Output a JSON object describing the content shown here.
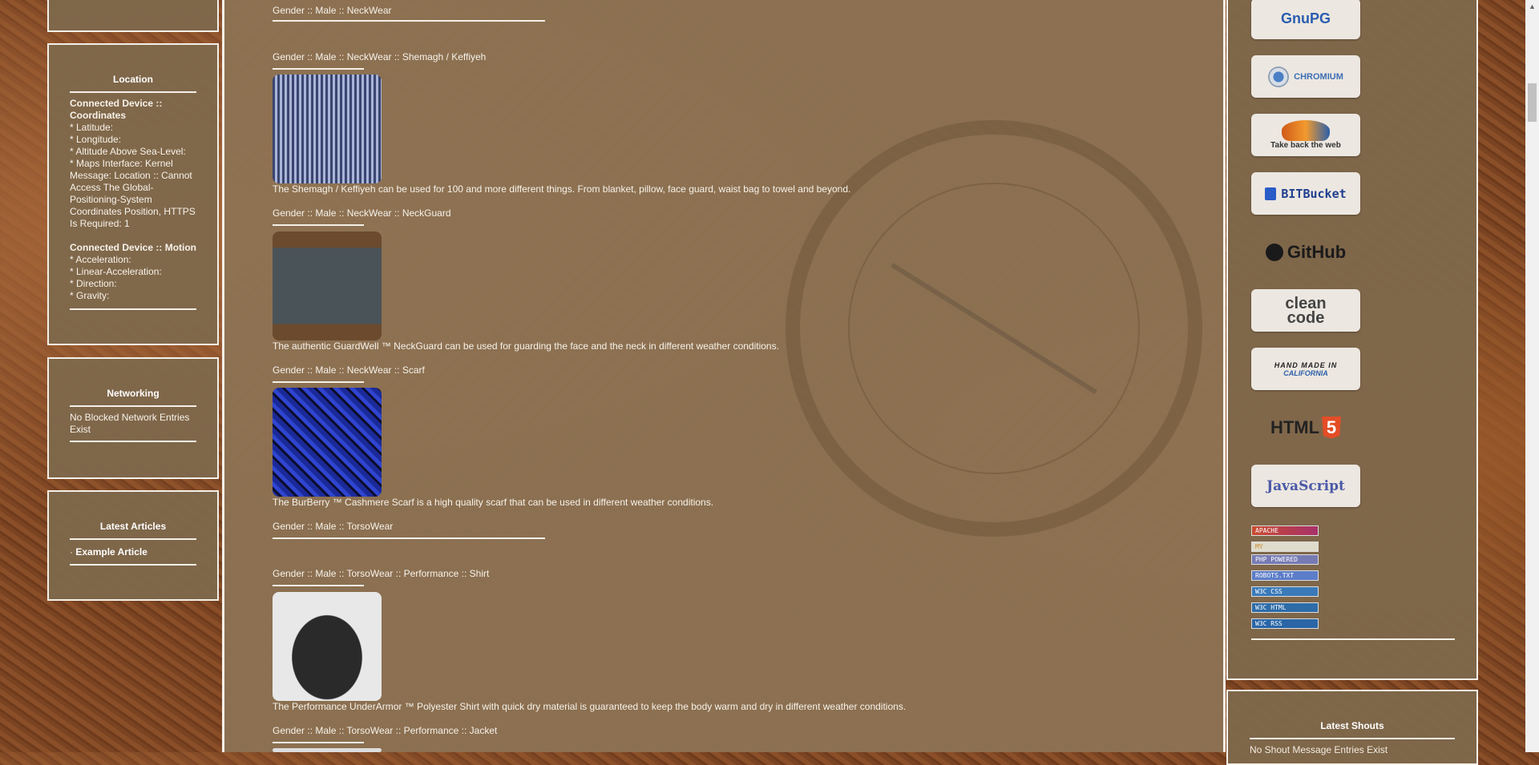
{
  "left_sidebar": {
    "location": {
      "title": "Location",
      "device_coords_heading": "Connected Device :: Coordinates",
      "lines": [
        "* Latitude:",
        "* Longitude:",
        "* Altitude Above Sea-Level:",
        "* Maps Interface: Kernel Message: Location :: Cannot Access The Global-Positioning-System Coordinates Position, HTTPS Is Required: 1"
      ],
      "motion_heading": "Connected Device :: Motion",
      "motion_lines": [
        "* Acceleration:",
        "* Linear-Acceleration:",
        "* Direction:",
        "* Gravity:"
      ]
    },
    "networking": {
      "title": "Networking",
      "text": "No Blocked Network Entries Exist"
    },
    "latest_articles": {
      "title": "Latest Articles",
      "bullet": "·",
      "item": "Example Article"
    }
  },
  "main": {
    "entries": [
      {
        "heading": "Gender :: Male :: NeckWear"
      },
      {
        "heading": "Gender :: Male :: NeckWear :: Shemagh / Keffiyeh",
        "desc": "The Shemagh / Keffiyeh can be used for 100 and more different things. From blanket, pillow, face guard, waist bag to towel and beyond."
      },
      {
        "heading": "Gender :: Male :: NeckWear :: NeckGuard",
        "desc": "The authentic GuardWell ™ NeckGuard can be used for guarding the face and the neck in different weather conditions."
      },
      {
        "heading": "Gender :: Male :: NeckWear :: Scarf",
        "desc": "The BurBerry ™ Cashmere Scarf is a high quality scarf that can be used in different weather conditions."
      },
      {
        "heading": "Gender :: Male :: TorsoWear"
      },
      {
        "heading": "Gender :: Male :: TorsoWear :: Performance :: Shirt",
        "desc": "The Performance UnderArmor ™ Polyester Shirt with quick dry material is guaranteed to keep the body warm and dry in different weather conditions."
      },
      {
        "heading": "Gender :: Male :: TorsoWear :: Performance :: Jacket"
      }
    ]
  },
  "right_sidebar": {
    "logos": {
      "gnupg": "GnuPG",
      "chromium": "CHROMIUM",
      "firefox": "Take back the web",
      "bitbucket": "BITBucket",
      "github": "GitHub",
      "cleancode_1": "clean",
      "cleancode_2": "code",
      "handmade_1": "HAND MADE IN",
      "handmade_2": "CALIFORNIA",
      "html5": "HTML",
      "javascript": "JavaScript"
    },
    "badges": [
      "APACHE",
      "MY",
      "PHP POWERED",
      "ROBOTS.TXT",
      "W3C CSS",
      "W3C HTML",
      "W3C RSS"
    ],
    "latest_shouts": {
      "title": "Latest Shouts",
      "text": "No Shout Message Entries Exist"
    }
  },
  "colors": {
    "panel": "#7e684c",
    "border": "#f4f0e8",
    "text": "#f7f2ea"
  }
}
